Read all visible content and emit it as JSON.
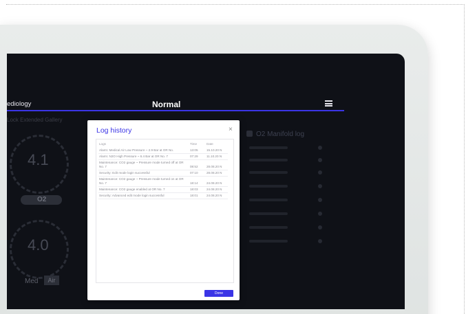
{
  "header": {
    "left_text": "ediology",
    "title": "Normal"
  },
  "background": {
    "subtitle": "Lock Extended Gallery",
    "gauge_top_value": "4.1",
    "gauge_bottom_value": "4.0",
    "pill_label": "O2",
    "bottom_label": "Med",
    "bottom_badge": "Air",
    "right_panel_title": "O2 Manifold log"
  },
  "dialog": {
    "title": "Log history",
    "close_symbol": "×",
    "columns": [
      "Logs",
      "Time",
      "Date"
    ],
    "rows": [
      {
        "log": "Alarm: Medical Air Low Pressure ~ 2.9 Bar at OR No.",
        "time": "13:05",
        "date": "15.10.20 N"
      },
      {
        "log": "Alarm: N2O High Pressure ~ 6.4 Bar at OR No. 7",
        "time": "07:29",
        "date": "11.10.20 N"
      },
      {
        "log": "Maintenance: CO2 gauge ~ Pressure mode turned off at OR No. 7",
        "time": "08:52",
        "date": "28.08.20 N"
      },
      {
        "log": "Security: Edit mode login successful",
        "time": "07:10",
        "date": "28.08.20 N"
      },
      {
        "log": "Maintenance: CO2 gauge ~ Pressure mode turned on at OR No. 7",
        "time": "18:14",
        "date": "24.08.20 N"
      },
      {
        "log": "Maintenance: CO2 gauge enabled at OR No. 7",
        "time": "18:03",
        "date": "24.08.20 N"
      },
      {
        "log": "Security: Advanced edit mode login successful",
        "time": "18:01",
        "date": "24.08.20 N"
      }
    ],
    "done_label": "Done"
  },
  "colors": {
    "accent": "#3b35e6",
    "screen_bg": "#0f1117",
    "device_frame": "#e5e8e7"
  }
}
